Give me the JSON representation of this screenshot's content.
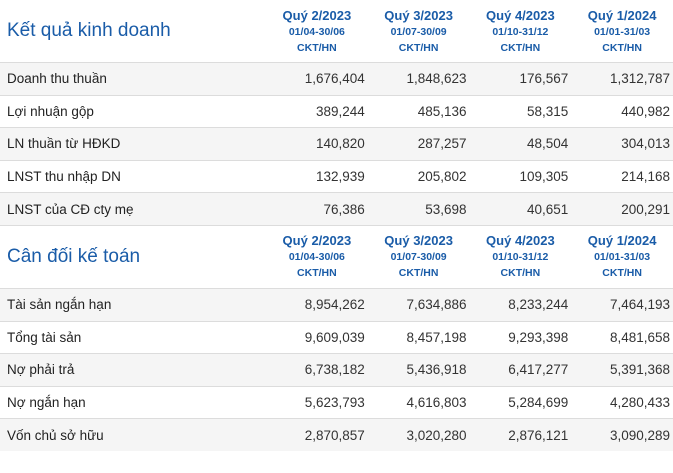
{
  "business": {
    "title": "Kết quả kinh doanh",
    "columns": [
      {
        "quarter": "Quý 2/2023",
        "range": "01/04-30/06",
        "audit": "CKT/HN"
      },
      {
        "quarter": "Quý 3/2023",
        "range": "01/07-30/09",
        "audit": "CKT/HN"
      },
      {
        "quarter": "Quý 4/2023",
        "range": "01/10-31/12",
        "audit": "CKT/HN"
      },
      {
        "quarter": "Quý 1/2024",
        "range": "01/01-31/03",
        "audit": "CKT/HN"
      }
    ],
    "rows": [
      {
        "label": "Doanh thu thuần",
        "values": [
          "1,676,404",
          "1,848,623",
          "176,567",
          "1,312,787"
        ]
      },
      {
        "label": "Lợi nhuận gộp",
        "values": [
          "389,244",
          "485,136",
          "58,315",
          "440,982"
        ]
      },
      {
        "label": "LN thuần từ HĐKD",
        "values": [
          "140,820",
          "287,257",
          "48,504",
          "304,013"
        ]
      },
      {
        "label": "LNST thu nhập DN",
        "values": [
          "132,939",
          "205,802",
          "109,305",
          "214,168"
        ]
      },
      {
        "label": "LNST của CĐ cty mẹ",
        "values": [
          "76,386",
          "53,698",
          "40,651",
          "200,291"
        ]
      }
    ]
  },
  "balance": {
    "title": "Cân đối kế toán",
    "columns": [
      {
        "quarter": "Quý 2/2023",
        "range": "01/04-30/06",
        "audit": "CKT/HN"
      },
      {
        "quarter": "Quý 3/2023",
        "range": "01/07-30/09",
        "audit": "CKT/HN"
      },
      {
        "quarter": "Quý 4/2023",
        "range": "01/10-31/12",
        "audit": "CKT/HN"
      },
      {
        "quarter": "Quý 1/2024",
        "range": "01/01-31/03",
        "audit": "CKT/HN"
      }
    ],
    "rows": [
      {
        "label": "Tài sản ngắn hạn",
        "values": [
          "8,954,262",
          "7,634,886",
          "8,233,244",
          "7,464,193"
        ]
      },
      {
        "label": "Tổng tài sản",
        "values": [
          "9,609,039",
          "8,457,198",
          "9,293,398",
          "8,481,658"
        ]
      },
      {
        "label": "Nợ phải trả",
        "values": [
          "6,738,182",
          "5,436,918",
          "6,417,277",
          "5,391,368"
        ]
      },
      {
        "label": "Nợ ngắn hạn",
        "values": [
          "5,623,793",
          "4,616,803",
          "5,284,699",
          "4,280,433"
        ]
      },
      {
        "label": "Vốn chủ sở hữu",
        "values": [
          "2,870,857",
          "3,020,280",
          "2,876,121",
          "3,090,289"
        ]
      }
    ]
  }
}
